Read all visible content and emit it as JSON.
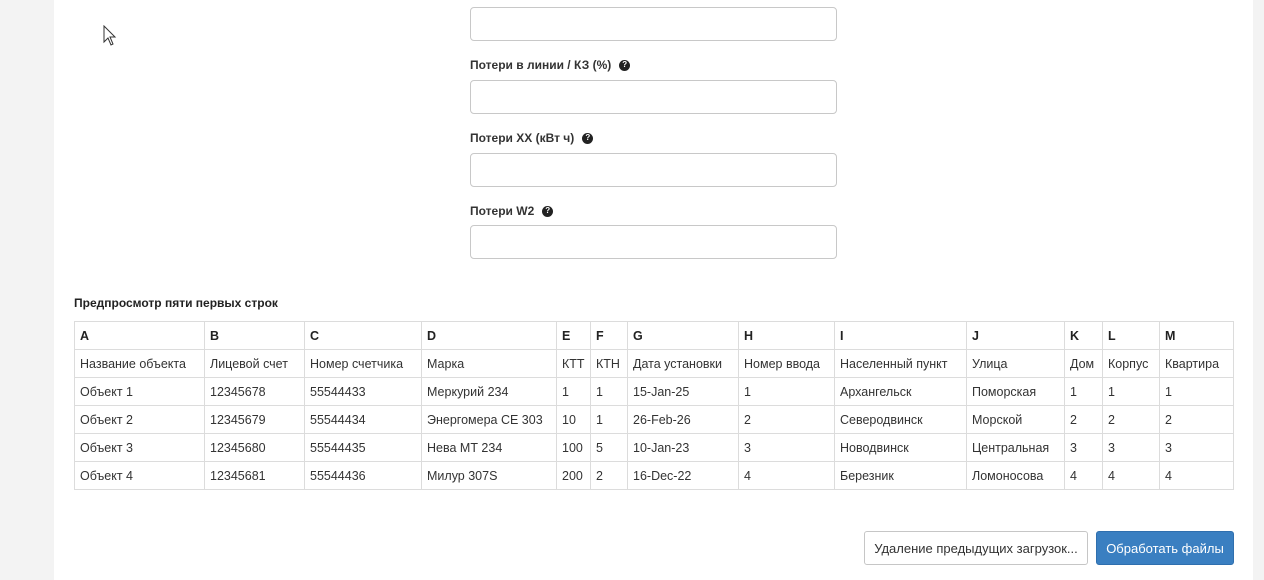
{
  "form": {
    "fields": [
      {
        "label": "",
        "value": ""
      },
      {
        "label": "Потери в линии / КЗ (%)",
        "value": ""
      },
      {
        "label": "Потери ХХ (кВт ч)",
        "value": ""
      },
      {
        "label": "Потери W2",
        "value": ""
      }
    ],
    "help_glyph": "?"
  },
  "preview": {
    "title": "Предпросмотр пяти первых строк",
    "letters": [
      "A",
      "B",
      "C",
      "D",
      "E",
      "F",
      "G",
      "H",
      "I",
      "J",
      "K",
      "L",
      "M"
    ],
    "headers": [
      "Название объекта",
      "Лицевой счет",
      "Номер счетчика",
      "Марка",
      "КТТ",
      "КТН",
      "Дата установки",
      "Номер ввода",
      "Населенный пункт",
      "Улица",
      "Дом",
      "Корпус",
      "Квартира"
    ],
    "rows": [
      [
        "Объект 1",
        "12345678",
        "55544433",
        "Меркурий 234",
        "1",
        "1",
        "15-Jan-25",
        "1",
        "Архангельск",
        "Поморская",
        "1",
        "1",
        "1"
      ],
      [
        "Объект 2",
        "12345679",
        "55544434",
        "Энергомера CE 303",
        "10",
        "1",
        "26-Feb-26",
        "2",
        "Северодвинск",
        "Морской",
        "2",
        "2",
        "2"
      ],
      [
        "Объект 3",
        "12345680",
        "55544435",
        "Нева МТ 234",
        "100",
        "5",
        "10-Jan-23",
        "3",
        "Новодвинск",
        "Центральная",
        "3",
        "3",
        "3"
      ],
      [
        "Объект 4",
        "12345681",
        "55544436",
        "Милур 307S",
        "200",
        "2",
        "16-Dec-22",
        "4",
        "Березник",
        "Ломоносова",
        "4",
        "4",
        "4"
      ]
    ]
  },
  "actions": {
    "delete_label": "Удаление предыдущих загрузок...",
    "process_label": "Обработать файлы"
  },
  "colors": {
    "primary": "#3a7fc1",
    "page_bg": "#f3f3f3",
    "panel_bg": "#ffffff"
  }
}
